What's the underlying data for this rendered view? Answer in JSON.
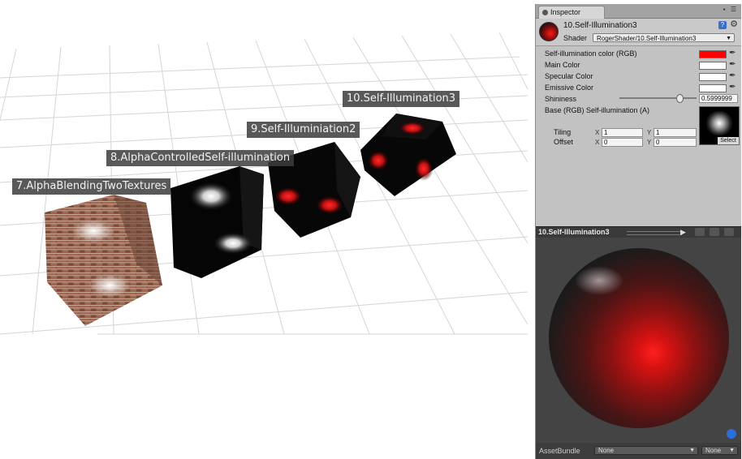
{
  "scene": {
    "labels": [
      "7.AlphaBlendingTwoTextures",
      "8.AlphaControlledSelf-illumination",
      "9.Self-Illuminiation2",
      "10.Self-Illumination3"
    ]
  },
  "inspector": {
    "tab_label": "Inspector",
    "material_name": "10.Self-Illumination3",
    "shader_label": "Shader",
    "shader_value": "RogerShader/10.Self-Illumination3",
    "properties": {
      "self_illum_label": "Self-illumination color (RGB)",
      "self_illum_color": "#ff0000",
      "main_color_label": "Main Color",
      "main_color": "#ffffff",
      "specular_label": "Specular Color",
      "specular_color": "#ffffff",
      "emissive_label": "Emissive Color",
      "emissive_color": "#ffffff",
      "shininess_label": "Shininess",
      "shininess_value": "0.5999999",
      "shininess_fraction": 0.78,
      "base_label": "Base (RGB) Self-illumination (A)",
      "tiling_label": "Tiling",
      "offset_label": "Offset",
      "x_label": "X",
      "y_label": "Y",
      "tiling_x": "1",
      "tiling_y": "1",
      "offset_x": "0",
      "offset_y": "0",
      "select_label": "Select"
    },
    "preview_title": "10.Self-Illumination3",
    "asset_bundle_label": "AssetBundle",
    "asset_bundle_value": "None",
    "asset_variant_value": "None"
  }
}
